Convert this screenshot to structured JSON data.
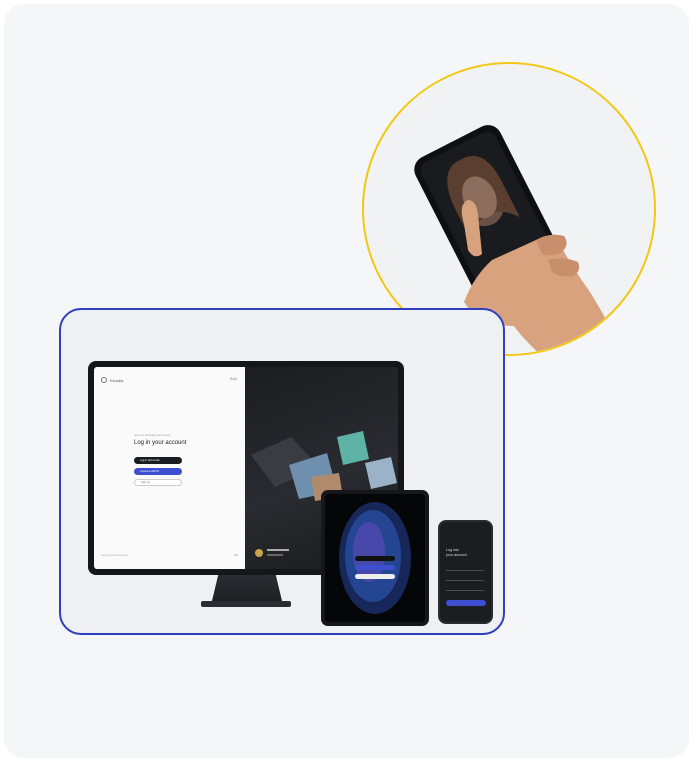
{
  "monitor": {
    "brand_name": "Kloudia",
    "help_label": "Help",
    "kicker": "Join the Kloudia community",
    "heading": "Log in your account",
    "btn_dark_label": "Log in with email",
    "btn_blue_label": "Continue with ID",
    "btn_outline_label": "Sign up",
    "legal": "Legal Notice  Privacy",
    "lang": "EN"
  },
  "phone": {
    "title_line1": "Log into",
    "title_line2": "your account"
  },
  "colors": {
    "circle_border": "#f2c814",
    "frame_border": "#2f3fbd",
    "accent_blue": "#3c4fd0"
  }
}
